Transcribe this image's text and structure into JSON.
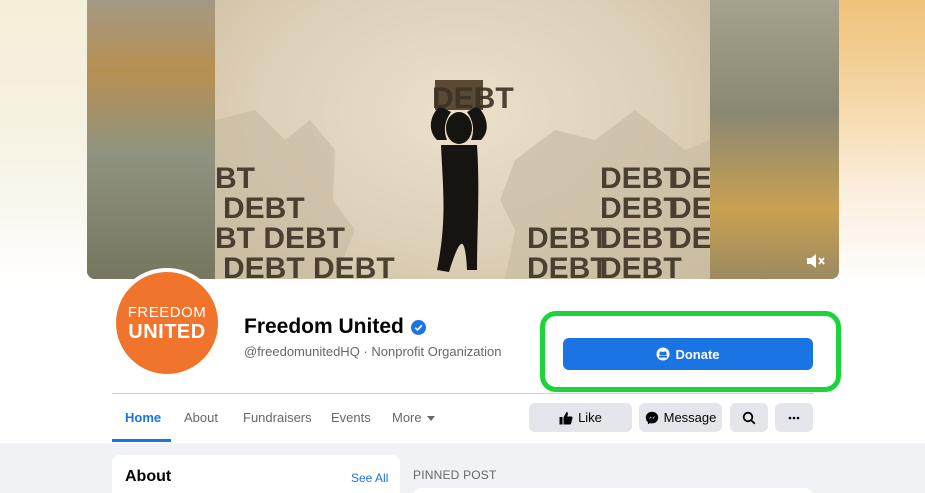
{
  "cover": {
    "frame_words": [
      "DEBT",
      "DEBT",
      "BT",
      "BT DEBT",
      "DEBT DEBT",
      "DEBT",
      "DEBT",
      "DEBT",
      "DEBT",
      "DEBT",
      "DEBT",
      "DEBT",
      "DEBT",
      "DEBT"
    ],
    "mute_icon": "speaker-muted-icon"
  },
  "profile": {
    "avatar_line1": "FREEDOM",
    "avatar_line2": "UNITED",
    "name": "Freedom United",
    "subtitle": "@freedomunitedHQ · Nonprofit Organization",
    "verified_icon": "verified-badge-icon"
  },
  "donate": {
    "label": "Donate",
    "icon": "donate-icon"
  },
  "tabs": [
    {
      "label": "Home",
      "active": true
    },
    {
      "label": "About"
    },
    {
      "label": "Fundraisers"
    },
    {
      "label": "Events"
    },
    {
      "label": "More"
    }
  ],
  "actions": {
    "like_label": "Like",
    "message_label": "Message"
  },
  "about": {
    "title": "About",
    "see_all": "See All"
  },
  "pinned": {
    "label": "PINNED POST"
  },
  "colors": {
    "accent": "#1b74e4",
    "highlight": "#1bd43a",
    "brand": "#f1742d"
  }
}
